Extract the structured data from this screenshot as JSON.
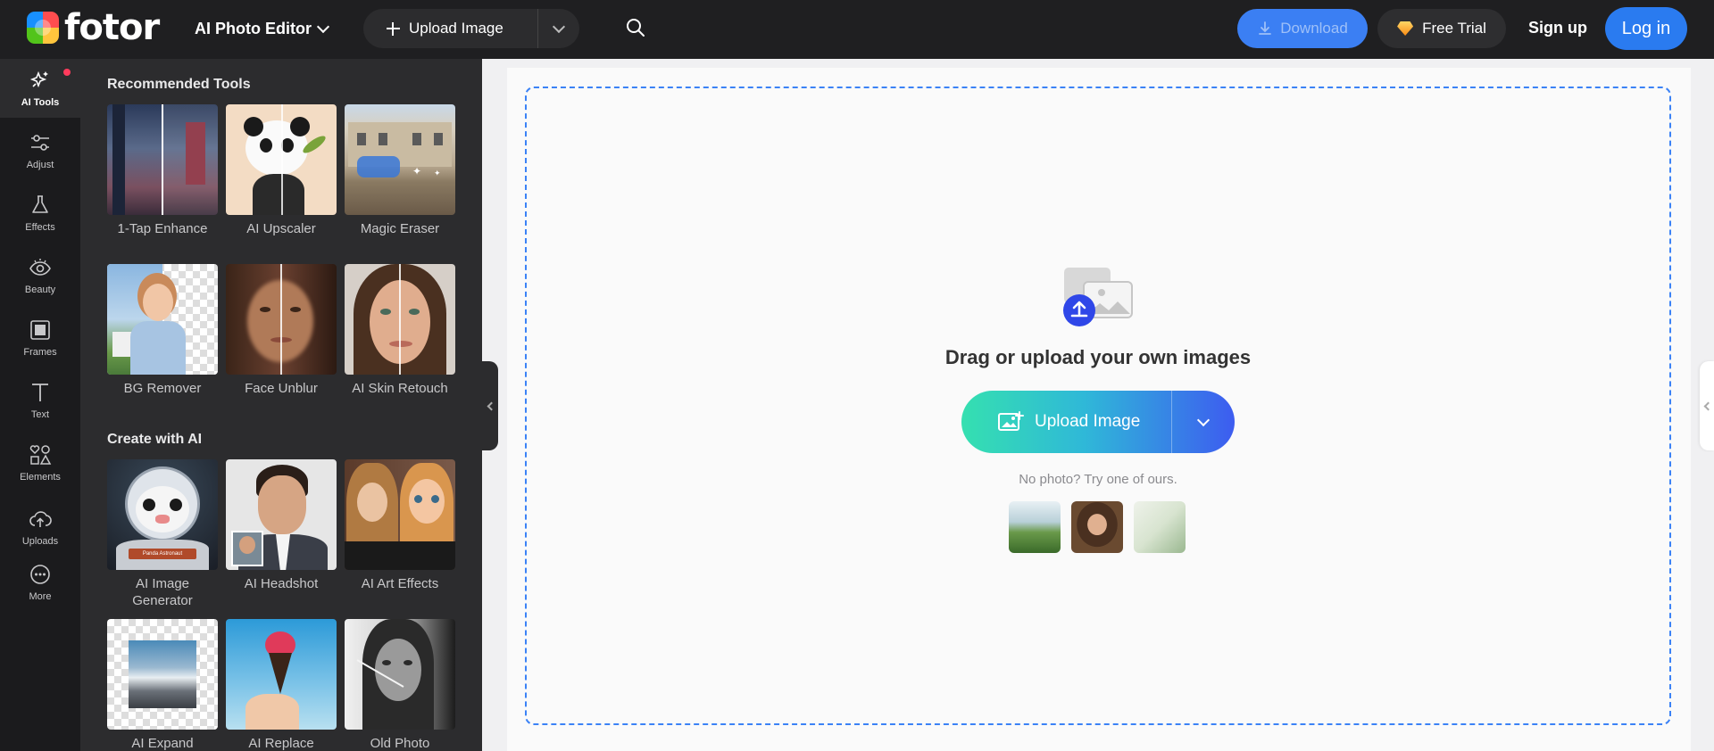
{
  "header": {
    "logo_text": "fotor",
    "editor_menu": "AI Photo Editor",
    "upload_button": "Upload Image",
    "download_button": "Download",
    "free_trial_button": "Free Trial",
    "signup": "Sign up",
    "login": "Log in"
  },
  "rail": {
    "items": [
      {
        "label": "AI Tools",
        "icon": "sparkle-icon",
        "active": true
      },
      {
        "label": "Adjust",
        "icon": "sliders-icon"
      },
      {
        "label": "Effects",
        "icon": "flask-icon"
      },
      {
        "label": "Beauty",
        "icon": "eye-icon"
      },
      {
        "label": "Frames",
        "icon": "frame-icon"
      },
      {
        "label": "Text",
        "icon": "text-icon"
      },
      {
        "label": "Elements",
        "icon": "shapes-icon"
      },
      {
        "label": "Uploads",
        "icon": "cloud-upload-icon"
      },
      {
        "label": "More",
        "icon": "more-icon"
      }
    ]
  },
  "panel": {
    "recommended_title": "Recommended Tools",
    "recommended": [
      {
        "label": "1-Tap Enhance"
      },
      {
        "label": "AI Upscaler"
      },
      {
        "label": "Magic Eraser"
      },
      {
        "label": "BG Remover"
      },
      {
        "label": "Face Unblur"
      },
      {
        "label": "AI Skin Retouch"
      }
    ],
    "create_title": "Create with AI",
    "create": [
      {
        "label": "AI Image Generator"
      },
      {
        "label": "AI Headshot"
      },
      {
        "label": "AI Art Effects"
      },
      {
        "label": "AI Expand"
      },
      {
        "label": "AI Replace"
      },
      {
        "label": "Old Photo"
      }
    ],
    "astronaut_caption": "Panda Astronaut"
  },
  "canvas": {
    "drag_title": "Drag or upload your own images",
    "upload_button": "Upload Image",
    "no_photo_text": "No photo? Try one of ours."
  },
  "colors": {
    "accent": "#2a7bf0",
    "dropzone_border": "#3b82f6",
    "topbar": "#1f1f21",
    "panel": "#2c2c2e"
  }
}
